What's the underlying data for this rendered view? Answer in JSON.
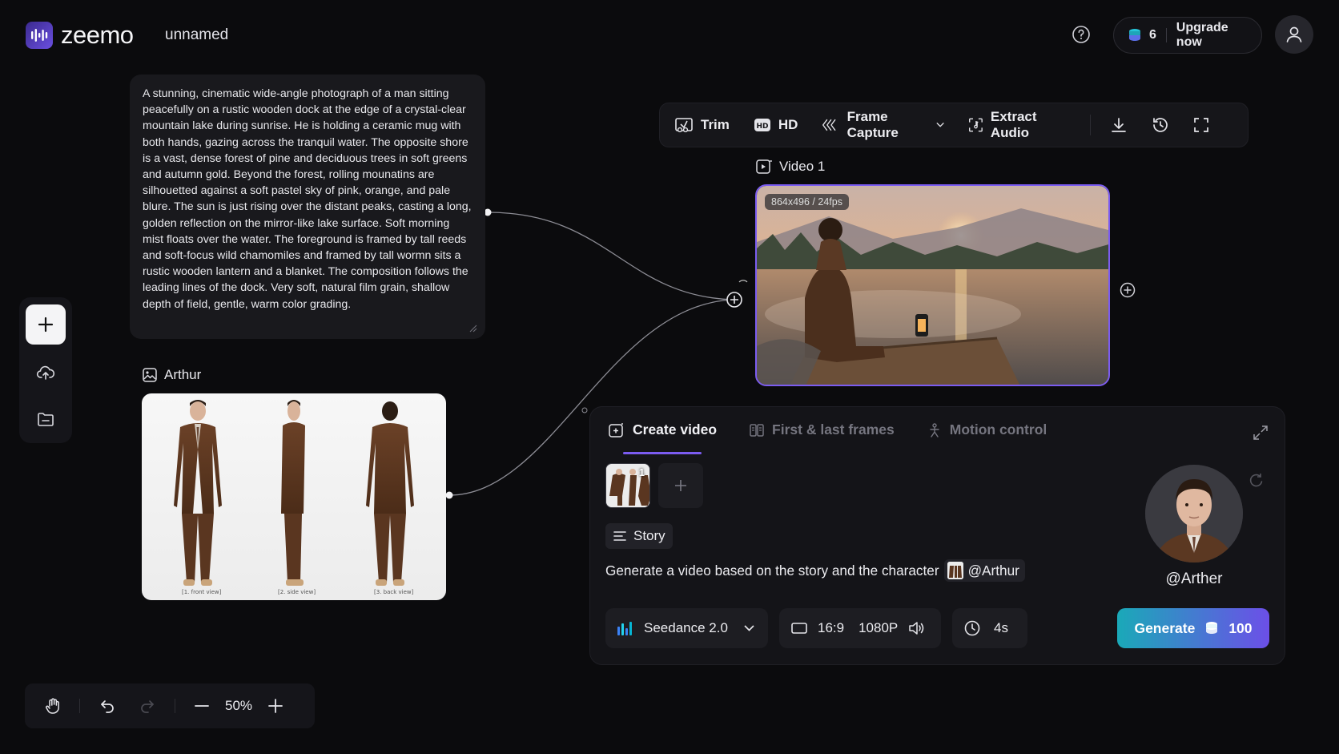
{
  "app": {
    "name": "zeemo",
    "project_name": "unnamed"
  },
  "header": {
    "credits": "6",
    "upgrade_label": "Upgrade now"
  },
  "prompt_card": {
    "text": "A stunning, cinematic wide-angle photograph of a man sitting peacefully on a rustic wooden dock at the edge of a crystal-clear mountain lake during sunrise. He is holding a ceramic mug with both hands, gazing across the tranquil water. The opposite shore is a vast, dense forest of pine and deciduous trees in soft greens and autumn gold. Beyond the forest, rolling mounatins are silhouetted against a soft pastel sky of pink, orange, and pale blure. The sun is just rising over the distant peaks, casting a long, golden reflection on the mirror-like lake surface. Soft morning mist floats over the water. The foreground is framed by tall reeds and soft-focus wild chamomiles and framed by tall wormn sits a rustic wooden lantern and a blanket. The composition follows the leading lines of the dock. Very soft, natural film grain, shallow depth of field, gentle, warm color grading."
  },
  "character_card": {
    "label": "Arthur",
    "views": [
      "[1. front view]",
      "[2. side view]",
      "[3. back view]"
    ]
  },
  "video_toolbar": {
    "trim": "Trim",
    "hd": "HD",
    "frame_capture": "Frame Capture",
    "extract_audio": "Extract Audio"
  },
  "video_node": {
    "label": "Video 1",
    "badge": "864x496 / 24fps"
  },
  "create_panel": {
    "tabs": [
      "Create video",
      "First & last frames",
      "Motion control"
    ],
    "active_tab": "Create video",
    "reference_count": "1",
    "story_label": "Story",
    "prompt": "Generate a video based on the story and the character",
    "mention": "@Arthur",
    "character_handle": "@Arther",
    "model": "Seedance 2.0",
    "aspect_ratio": "16:9",
    "resolution": "1080P",
    "duration": "4s",
    "generate_label": "Generate",
    "cost": "100"
  },
  "zoom": {
    "level": "50%"
  },
  "colors": {
    "accent": "#7b5cf0",
    "generate_from": "#1aa9b8",
    "generate_to": "#6c4fe8"
  }
}
